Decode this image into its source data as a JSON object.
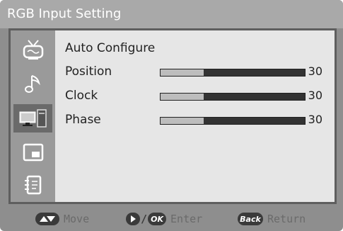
{
  "title": "RGB Input Setting",
  "sidebar": {
    "items": [
      {
        "icon": "tv-channel-icon"
      },
      {
        "icon": "music-note-icon"
      },
      {
        "icon": "pc-monitor-icon",
        "active": true
      },
      {
        "icon": "picture-in-picture-icon"
      },
      {
        "icon": "setup-book-icon"
      }
    ]
  },
  "menu": {
    "auto_configure": "Auto Configure",
    "rows": [
      {
        "label": "Position",
        "value": "30",
        "level": 0.3
      },
      {
        "label": "Clock",
        "value": "30",
        "level": 0.3
      },
      {
        "label": "Phase",
        "value": "30",
        "level": 0.3
      }
    ]
  },
  "footer": {
    "move": "Move",
    "ok_key": "OK",
    "enter_sep": "/",
    "enter": "Enter",
    "back_key": "Back",
    "return": "Return"
  }
}
